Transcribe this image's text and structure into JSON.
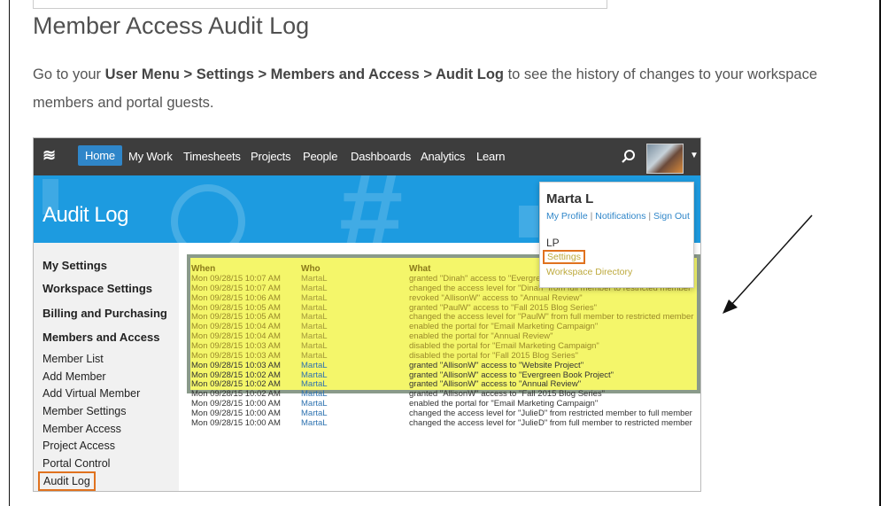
{
  "doc": {
    "title": "Member Access Audit Log",
    "intro_prefix": "Go to your ",
    "intro_path": "User Menu > Settings > Members and Access > Audit Log",
    "intro_suffix": " to see the history of changes to your workspace members and portal guests."
  },
  "nav": {
    "logo": "≋",
    "items": [
      "Home",
      "My Work",
      "Timesheets",
      "Projects",
      "People",
      "Dashboards",
      "Analytics",
      "Learn"
    ],
    "active": "Home"
  },
  "banner": {
    "title": "Audit Log"
  },
  "user_menu": {
    "name": "Marta L",
    "links": [
      "My Profile",
      "Notifications",
      "Sign Out"
    ],
    "workspace": "LP",
    "settings": "Settings",
    "directory": "Workspace Directory"
  },
  "sidebar": {
    "items": [
      {
        "label": "My Settings",
        "section": true
      },
      {
        "label": "Workspace Settings",
        "section": true
      },
      {
        "label": "Billing and Purchasing",
        "section": true
      },
      {
        "label": "Members and Access",
        "section": true
      },
      {
        "label": "Member List",
        "section": false
      },
      {
        "label": "Add Member",
        "section": false
      },
      {
        "label": "Add Virtual Member",
        "section": false
      },
      {
        "label": "Member Settings",
        "section": false
      },
      {
        "label": "Member Access",
        "section": false
      },
      {
        "label": "Project Access",
        "section": false
      },
      {
        "label": "Portal Control",
        "section": false
      },
      {
        "label": "Audit Log",
        "section": false,
        "active": true
      }
    ]
  },
  "audit": {
    "columns": [
      "When",
      "Who",
      "What"
    ],
    "highlighted_count": 10,
    "rows": [
      {
        "when": "Mon 09/28/15 10:07 AM",
        "who": "MartaL",
        "what": "granted \"Dinah\" access to \"Evergreen"
      },
      {
        "when": "Mon 09/28/15 10:07 AM",
        "who": "MartaL",
        "what": "changed the access level for \"Dinah\" from full member to restricted member"
      },
      {
        "when": "Mon 09/28/15 10:06 AM",
        "who": "MartaL",
        "what": "revoked \"AllisonW\" access to \"Annual Review\""
      },
      {
        "when": "Mon 09/28/15 10:05 AM",
        "who": "MartaL",
        "what": "granted \"PaulW\" access to \"Fall 2015 Blog Series\""
      },
      {
        "when": "Mon 09/28/15 10:05 AM",
        "who": "MartaL",
        "what": "changed the access level for \"PaulW\" from full member to restricted member"
      },
      {
        "when": "Mon 09/28/15 10:04 AM",
        "who": "MartaL",
        "what": "enabled the portal for \"Email Marketing Campaign\""
      },
      {
        "when": "Mon 09/28/15 10:04 AM",
        "who": "MartaL",
        "what": "enabled the portal for \"Annual Review\""
      },
      {
        "when": "Mon 09/28/15 10:03 AM",
        "who": "MartaL",
        "what": "disabled the portal for \"Email Marketing Campaign\""
      },
      {
        "when": "Mon 09/28/15 10:03 AM",
        "who": "MartaL",
        "what": "disabled the portal for \"Fall 2015 Blog Series\""
      },
      {
        "when": "Mon 09/28/15 10:03 AM",
        "who": "MartaL",
        "what": "granted \"AllisonW\" access to \"Website Project\""
      },
      {
        "when": "Mon 09/28/15 10:02 AM",
        "who": "MartaL",
        "what": "granted \"AllisonW\" access to \"Evergreen Book Project\""
      },
      {
        "when": "Mon 09/28/15 10:02 AM",
        "who": "MartaL",
        "what": "granted \"AllisonW\" access to \"Annual Review\""
      },
      {
        "when": "Mon 09/28/15 10:02 AM",
        "who": "MartaL",
        "what": "granted \"AllisonW\" access to \"Fall 2015 Blog Series\""
      },
      {
        "when": "Mon 09/28/15 10:00 AM",
        "who": "MartaL",
        "what": "enabled the portal for \"Email Marketing Campaign\""
      },
      {
        "when": "Mon 09/28/15 10:00 AM",
        "who": "MartaL",
        "what": "changed the access level for \"JulieD\" from restricted member to full member"
      },
      {
        "when": "Mon 09/28/15 10:00 AM",
        "who": "MartaL",
        "what": "changed the access level for \"JulieD\" from full member to restricted member"
      }
    ]
  }
}
